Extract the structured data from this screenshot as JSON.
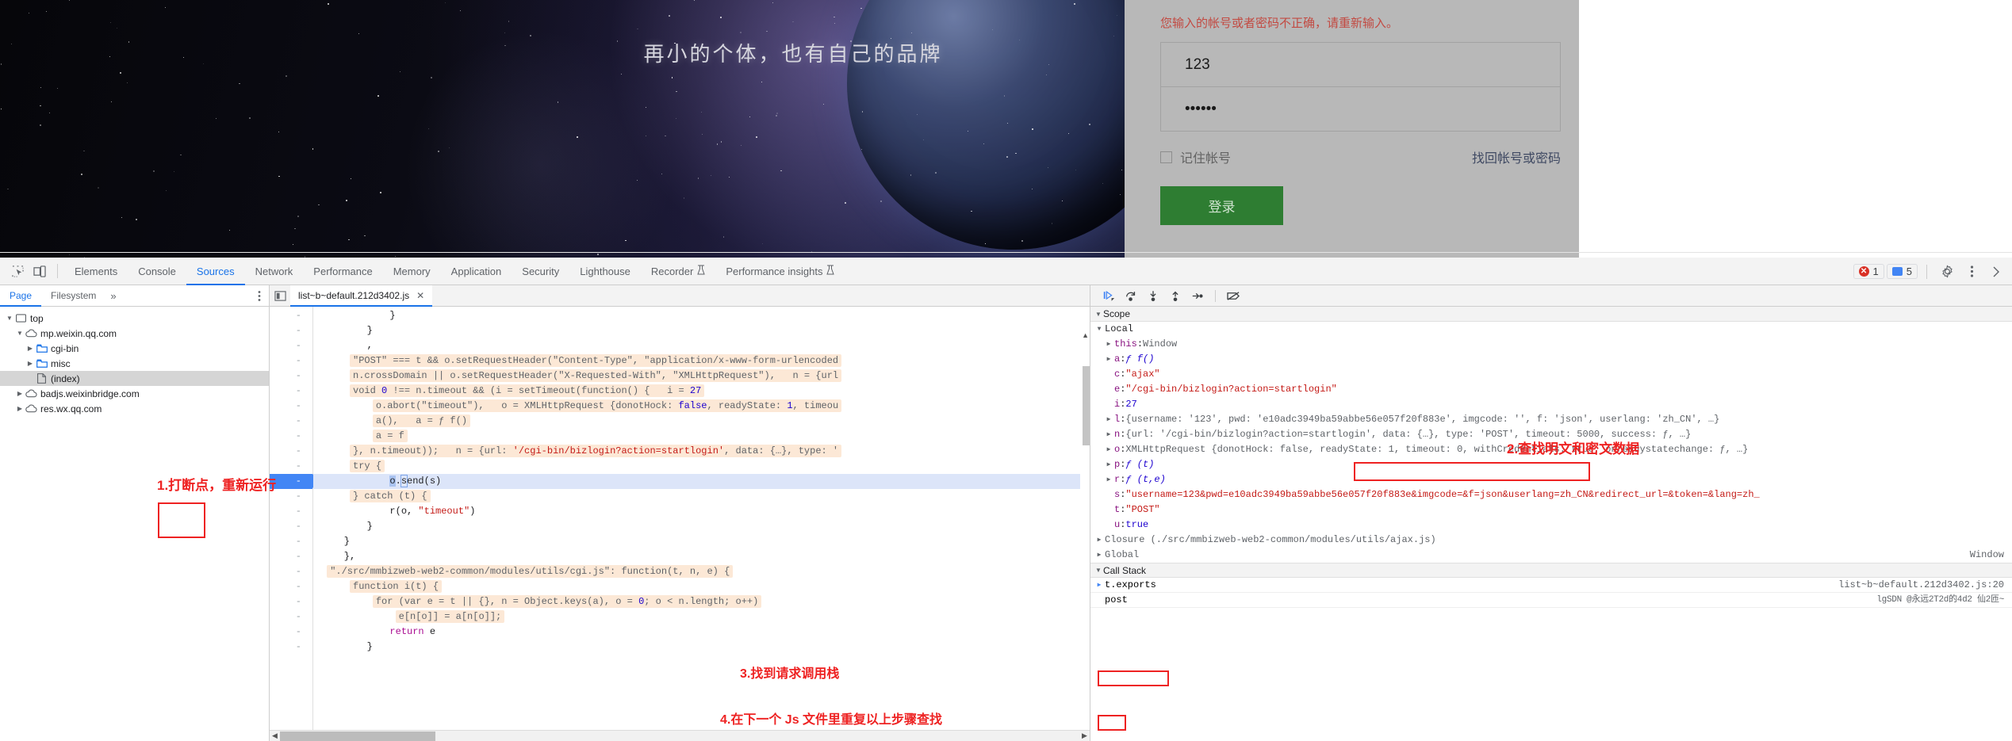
{
  "page": {
    "hero_title": "再小的个体，也有自己的品牌",
    "login": {
      "error": "您输入的帐号或者密码不正确，请重新输入。",
      "username_value": "123",
      "username_placeholder": "",
      "password_value": "••••••",
      "password_placeholder": "",
      "remember_label": "记住帐号",
      "forgot_label": "找回帐号或密码",
      "submit_label": "登录"
    }
  },
  "devtools": {
    "tabs": [
      {
        "label": "Elements",
        "active": false
      },
      {
        "label": "Console",
        "active": false
      },
      {
        "label": "Sources",
        "active": true
      },
      {
        "label": "Network",
        "active": false
      },
      {
        "label": "Performance",
        "active": false
      },
      {
        "label": "Memory",
        "active": false
      },
      {
        "label": "Application",
        "active": false
      },
      {
        "label": "Security",
        "active": false
      },
      {
        "label": "Lighthouse",
        "active": false
      },
      {
        "label": "Recorder",
        "active": false,
        "experiment": true
      },
      {
        "label": "Performance insights",
        "active": false,
        "experiment": true
      }
    ],
    "error_count": "1",
    "message_count": "5",
    "navigator": {
      "tabs": [
        {
          "label": "Page",
          "active": true
        },
        {
          "label": "Filesystem",
          "active": false
        }
      ],
      "more_label": "»",
      "tree": [
        {
          "label": "top",
          "indent": 0,
          "twisty": "down",
          "icon": "frame-icon",
          "selected": false
        },
        {
          "label": "mp.weixin.qq.com",
          "indent": 1,
          "twisty": "down",
          "icon": "cloud-icon",
          "selected": false
        },
        {
          "label": "cgi-bin",
          "indent": 2,
          "twisty": "right",
          "icon": "folder-icon",
          "selected": false
        },
        {
          "label": "misc",
          "indent": 2,
          "twisty": "right",
          "icon": "folder-icon",
          "selected": false
        },
        {
          "label": "(index)",
          "indent": 2,
          "twisty": "none",
          "icon": "document-icon",
          "selected": true
        },
        {
          "label": "badjs.weixinbridge.com",
          "indent": 1,
          "twisty": "right",
          "icon": "cloud-icon",
          "selected": false
        },
        {
          "label": "res.wx.qq.com",
          "indent": 1,
          "twisty": "right",
          "icon": "cloud-icon",
          "selected": false
        }
      ]
    },
    "editor": {
      "file_tab": "list~b~default.212d3402.js",
      "close_label": "✕",
      "gutter_mark": "-",
      "lines": [
        {
          "text": "            }"
        },
        {
          "text": "        }"
        },
        {
          "text": "        ,"
        },
        {
          "text": "        \"POST\" === t && o.setRequestHeader(\"Content-Type\", \"application/x-www-form-urlencoded"
        },
        {
          "text": "        n.crossDomain || o.setRequestHeader(\"X-Requested-With\", \"XMLHttpRequest\"),   n = {url"
        },
        {
          "text": "        void 0 !== n.timeout && (i = setTimeout(function() {   i = 27"
        },
        {
          "text": "            o.abort(\"timeout\"),   o = XMLHttpRequest {donotHock: false, readyState: 1, timeou"
        },
        {
          "text": "            a(),   a = ƒ f()"
        },
        {
          "text": "            a = f"
        },
        {
          "text": "        }, n.timeout));   n = {url: '/cgi-bin/bizlogin?action=startlogin', data: {…}, type: '"
        },
        {
          "text": "        try {"
        },
        {
          "text": "            o.send(s)",
          "executing": true
        },
        {
          "text": "        } catch (t) {"
        },
        {
          "text": "            r(o, \"timeout\")"
        },
        {
          "text": "        }"
        },
        {
          "text": "    }"
        },
        {
          "text": "    },"
        },
        {
          "text": "    \"./src/mmbizweb-web2-common/modules/utils/cgi.js\": function(t, n, e) {"
        },
        {
          "text": "        function i(t) {"
        },
        {
          "text": "            for (var e = t || {}, n = Object.keys(a), o = 0; o < n.length; o++)"
        },
        {
          "text": "                e[n[o]] = a[n[o]];"
        },
        {
          "text": "            return e"
        },
        {
          "text": "        }"
        }
      ]
    },
    "debugger": {
      "scope_header": "Scope",
      "scope_groups": [
        {
          "label": "Local",
          "expanded": true
        }
      ],
      "scope_rows": [
        {
          "arrow": true,
          "name": "this",
          "value": "Window",
          "kind": "obj"
        },
        {
          "arrow": true,
          "name": "a",
          "value": "ƒ f()",
          "kind": "fn"
        },
        {
          "arrow": false,
          "name": "c",
          "value": "\"ajax\"",
          "kind": "str"
        },
        {
          "arrow": false,
          "name": "e",
          "value": "\"/cgi-bin/bizlogin?action=startlogin\"",
          "kind": "str"
        },
        {
          "arrow": false,
          "name": "i",
          "value": "27",
          "kind": "num"
        },
        {
          "arrow": true,
          "name": "l",
          "value": "{username: '123', pwd: 'e10adc3949ba59abbe56e057f20f883e', imgcode: '', f: 'json', userlang: 'zh_CN', …}",
          "kind": "obj"
        },
        {
          "arrow": true,
          "name": "n",
          "value": "{url: '/cgi-bin/bizlogin?action=startlogin', data: {…}, type: 'POST', timeout: 5000, success: ƒ, …}",
          "kind": "obj"
        },
        {
          "arrow": true,
          "name": "o",
          "value": "XMLHttpRequest {donotHock: false, readyState: 1, timeout: 0, withCredentials: true, onreadystatechange: ƒ, …}",
          "kind": "obj"
        },
        {
          "arrow": true,
          "name": "p",
          "value": "ƒ (t)",
          "kind": "fn"
        },
        {
          "arrow": true,
          "name": "r",
          "value": "ƒ (t,e)",
          "kind": "fn"
        },
        {
          "arrow": false,
          "name": "s",
          "value": "\"username=123&pwd=e10adc3949ba59abbe56e057f20f883e&imgcode=&f=json&userlang=zh_CN&redirect_url=&token=&lang=zh_",
          "kind": "str"
        },
        {
          "arrow": false,
          "name": "t",
          "value": "\"POST\"",
          "kind": "str"
        },
        {
          "arrow": false,
          "name": "u",
          "value": "true",
          "kind": "kw"
        }
      ],
      "closure_row": {
        "label": "Closure (./src/mmbizweb-web2-common/modules/utils/ajax.js)"
      },
      "global_row": {
        "label": "Global",
        "right": "Window"
      },
      "callstack_header": "Call Stack",
      "callstack": [
        {
          "name": "t.exports",
          "location": "list~b~default.212d3402.js:20",
          "current": true
        },
        {
          "name": "post",
          "location": "lgSDN @永远2T2d的4d2 仙2匝~",
          "current": false
        }
      ]
    }
  },
  "annotations": [
    {
      "id": "a1",
      "text": "1.打断点，重新运行"
    },
    {
      "id": "a2",
      "text": "2.查找明文和密文数据"
    },
    {
      "id": "a3",
      "text": "3.找到请求调用栈"
    },
    {
      "id": "a4",
      "text": "4.在下一个 Js 文件里重复以上步骤查找"
    }
  ],
  "colors": {
    "accent": "#1a73e8",
    "error_red": "#d93025",
    "annotation_red": "#ee2222",
    "login_green": "#2e7d32",
    "highlight_bg": "#fce8d6"
  }
}
